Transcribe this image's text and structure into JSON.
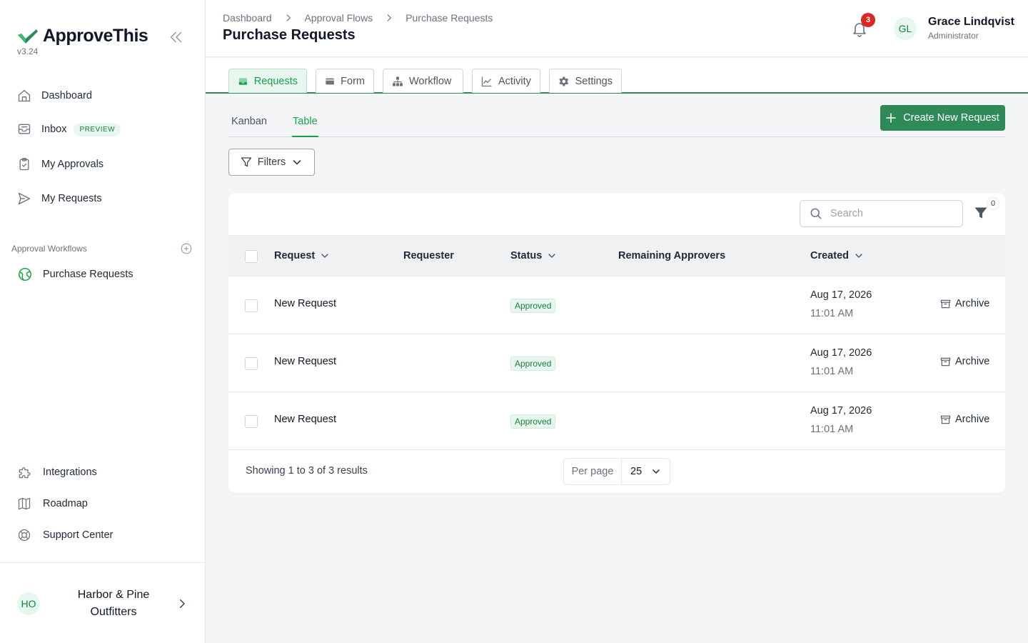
{
  "app": {
    "name": "ApproveThis",
    "version": "v3.24"
  },
  "sidebar": {
    "nav": [
      {
        "label": "Dashboard",
        "icon": "home-icon"
      },
      {
        "label": "Inbox",
        "icon": "inbox-icon",
        "badge": "PREVIEW"
      },
      {
        "label": "My Approvals",
        "icon": "clipboard-check-icon"
      },
      {
        "label": "My Requests",
        "icon": "send-icon"
      }
    ],
    "section_label": "Approval Workflows",
    "workflows": [
      {
        "label": "Purchase Requests",
        "icon": "globe-icon"
      }
    ],
    "bottom": [
      {
        "label": "Integrations",
        "icon": "puzzle-icon"
      },
      {
        "label": "Roadmap",
        "icon": "map-icon"
      },
      {
        "label": "Support Center",
        "icon": "lifebuoy-icon"
      }
    ],
    "org": {
      "initials": "HO",
      "name": "Harbor & Pine Outfitters"
    }
  },
  "header": {
    "breadcrumb": [
      "Dashboard",
      "Approval Flows",
      "Purchase Requests"
    ],
    "title": "Purchase Requests",
    "notifications_count": "3",
    "user": {
      "initials": "GL",
      "name": "Grace Lindqvist",
      "role": "Administrator"
    }
  },
  "tabs": [
    {
      "label": "Requests",
      "icon": "tray-icon",
      "active": true
    },
    {
      "label": "Form",
      "icon": "card-icon",
      "active": false
    },
    {
      "label": "Workflow",
      "icon": "hierarchy-icon",
      "active": false
    },
    {
      "label": "Activity",
      "icon": "chart-line-icon",
      "active": false
    },
    {
      "label": "Settings",
      "icon": "gear-icon",
      "active": false
    }
  ],
  "views": {
    "items": [
      "Kanban",
      "Table"
    ],
    "active": "Table"
  },
  "create_button": "Create New Request",
  "filters_button": "Filters",
  "table": {
    "search_placeholder": "Search",
    "column_filter_count": "0",
    "columns": [
      "Request",
      "Requester",
      "Status",
      "Remaining Approvers",
      "Created"
    ],
    "rows": [
      {
        "request": "New Request",
        "requester": "",
        "status": "Approved",
        "remaining": "",
        "created_date": "Aug 17, 2026",
        "created_time": "11:01 AM",
        "action": "Archive"
      },
      {
        "request": "New Request",
        "requester": "",
        "status": "Approved",
        "remaining": "",
        "created_date": "Aug 17, 2026",
        "created_time": "11:01 AM",
        "action": "Archive"
      },
      {
        "request": "New Request",
        "requester": "",
        "status": "Approved",
        "remaining": "",
        "created_date": "Aug 17, 2026",
        "created_time": "11:01 AM",
        "action": "Archive"
      }
    ],
    "results_text": "Showing 1 to 3 of 3 results",
    "per_page_label": "Per page",
    "per_page_value": "25"
  },
  "colors": {
    "accent": "#2e8b57",
    "accent_text": "#16a34a",
    "badge_red": "#dc2626"
  }
}
